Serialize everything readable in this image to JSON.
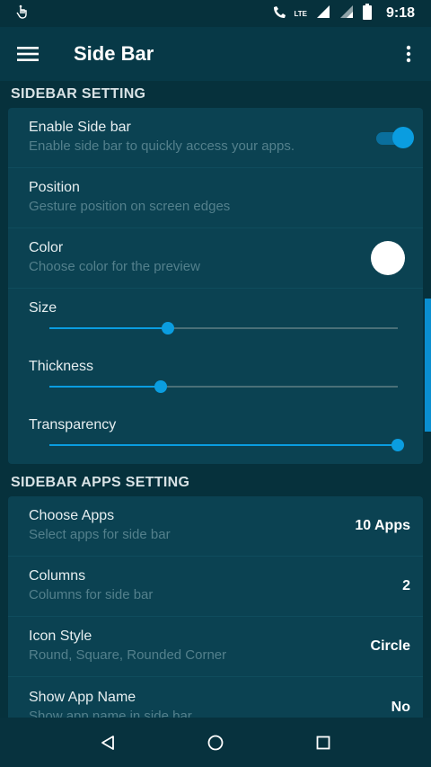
{
  "status_bar": {
    "time": "9:18",
    "lte_label": "LTE",
    "icons": [
      "touch-icon",
      "phone-wifi-icon",
      "signal-icon",
      "signal-icon",
      "battery-icon"
    ]
  },
  "app_bar": {
    "title": "Side Bar",
    "menu_icon": "hamburger-icon",
    "overflow_icon": "more-vert-icon"
  },
  "sidebar_setting": {
    "header": "SIDEBAR SETTING",
    "enable": {
      "title": "Enable Side bar",
      "subtitle": "Enable side bar to quickly access your apps.",
      "on": true
    },
    "position": {
      "title": "Position",
      "subtitle": "Gesture position on screen edges"
    },
    "color": {
      "title": "Color",
      "subtitle": "Choose color for the preview",
      "swatch": "#ffffff"
    },
    "size": {
      "title": "Size",
      "level": 0.34
    },
    "thickness": {
      "title": "Thickness",
      "level": 0.32
    },
    "transparency": {
      "title": "Transparency",
      "level": 1.0
    }
  },
  "sidebar_apps_setting": {
    "header": "SIDEBAR APPS SETTING",
    "items": [
      {
        "title": "Choose Apps",
        "subtitle": "Select apps for side bar",
        "value": "10 Apps"
      },
      {
        "title": "Columns",
        "subtitle": "Columns for side bar",
        "value": "2"
      },
      {
        "title": "Icon Style",
        "subtitle": "Round, Square, Rounded Corner",
        "value": "Circle"
      },
      {
        "title": "Show App Name",
        "subtitle": "Show app name in side bar",
        "value": "No"
      }
    ]
  },
  "nav_bar": {
    "icons": [
      "back-icon",
      "home-icon",
      "recents-icon"
    ]
  },
  "colors": {
    "accent": "#0a9de0",
    "background": "#06313c",
    "card": "#0b4252"
  }
}
